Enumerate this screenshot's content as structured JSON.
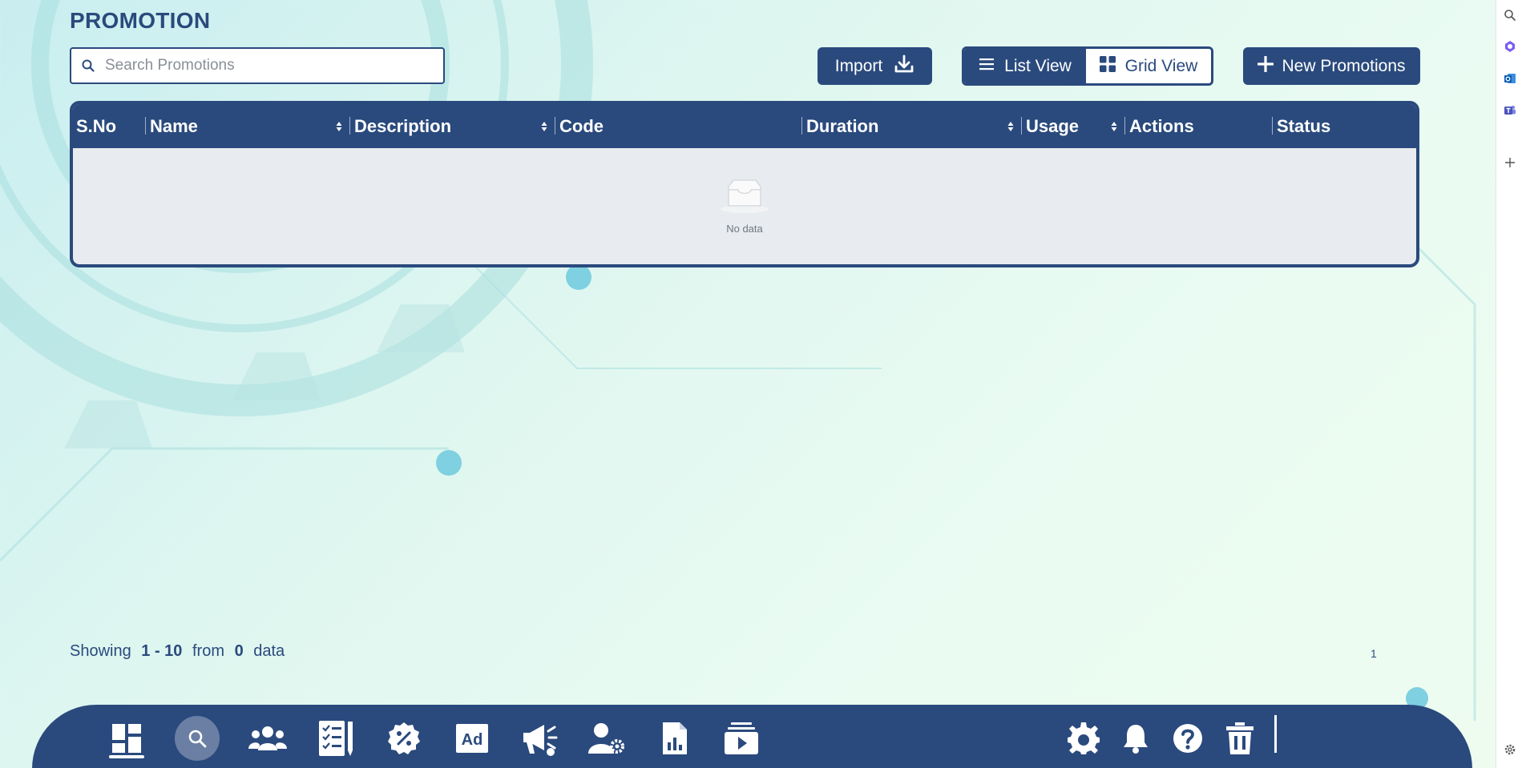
{
  "page": {
    "title": "PROMOTION"
  },
  "search": {
    "placeholder": "Search Promotions",
    "value": ""
  },
  "toolbar": {
    "import_label": "Import",
    "list_view_label": "List View",
    "grid_view_label": "Grid View",
    "new_label": "New Promotions"
  },
  "table": {
    "columns": [
      "S.No",
      "Name",
      "Description",
      "Code",
      "Duration",
      "Usage",
      "Actions",
      "Status"
    ],
    "sortable": [
      false,
      true,
      true,
      false,
      true,
      true,
      false,
      false
    ],
    "rows": [],
    "empty_text": "No data"
  },
  "pagination": {
    "showing_label": "Showing",
    "range": "1 - 10",
    "from_label": "from",
    "total": "0",
    "data_label": "data",
    "current_page": "1"
  },
  "dock": {
    "left_icons": [
      "dashboard-icon",
      "search-icon",
      "users-icon",
      "checklist-icon",
      "discount-icon",
      "ad-icon",
      "megaphone-icon",
      "user-settings-icon",
      "report-icon",
      "media-icon"
    ],
    "right_icons": [
      "gear-icon",
      "bell-icon",
      "help-icon",
      "trash-icon"
    ],
    "active": "dashboard-icon"
  },
  "right_strip": {
    "icons": [
      "search-icon",
      "copilot-icon",
      "outlook-icon",
      "teams-icon",
      "plus-icon",
      "settings-icon"
    ]
  },
  "colors": {
    "primary": "#2a4a7d",
    "table_body": "#e8ebef",
    "accent_light": "#6a7fa3"
  }
}
